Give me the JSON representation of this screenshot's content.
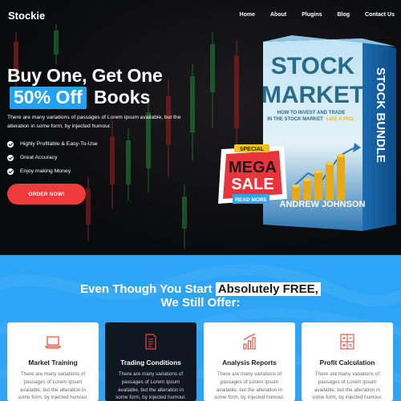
{
  "header": {
    "logo": "Stockie",
    "nav": [
      "Home",
      "About",
      "Plugins",
      "Blog",
      "Contact Us"
    ]
  },
  "hero": {
    "headline_line1": "Buy One, Get One",
    "headline_highlight": "50% Off",
    "headline_line2_rest": "Books",
    "description": "There are many variations of passages of Lorem Ipsum available, but the alteration in some form, by injected humour.",
    "features": [
      "Highly Profitable & Easy-To-Use",
      "Great Accuracy",
      "Enjoy making Money"
    ],
    "cta_label": "ORDER NOW!"
  },
  "book": {
    "title_line1": "STOCK",
    "title_line2": "MARKET",
    "subtitle_line1": "HOW TO INVEST AND TRADE",
    "subtitle_line2": "IN THE STOCK MARKET",
    "subtitle_highlight": "LIKE A PRO",
    "author": "ANDREW JOHNSON",
    "spine": "STOCK BUNDLE"
  },
  "badge": {
    "special": "SPECIAL",
    "line1": "MEGA",
    "line2": "SALE",
    "read_more": "READ MORE"
  },
  "offer": {
    "title_prefix": "Even Though You Start",
    "title_highlight": "Absolutely FREE,",
    "title_line2": "We Still Offer:",
    "cards": [
      {
        "title": "Market Training",
        "text": "There are many variations of passages of Lorem Ipsum available, but the alteration in some form, by injected humour.",
        "icon": "laptop-icon",
        "dark": false
      },
      {
        "title": "Trading Conditions",
        "text": "There are many variations of passages of Lorem Ipsum available, but the alteration in some form, by injected humour.",
        "icon": "document-icon",
        "dark": true
      },
      {
        "title": "Analysis Reports",
        "text": "There are many variations of passages of Lorem Ipsum available, but the alteration in some form, by injected humour.",
        "icon": "bar-chart-icon",
        "dark": false
      },
      {
        "title": "Profit Calculation",
        "text": "There are many variations of passages of Lorem Ipsum available, but the alteration in some form, by injected humour.",
        "icon": "calculator-icon",
        "dark": false
      }
    ]
  },
  "colors": {
    "accent_blue": "#2da4f5",
    "cta_red": "#ef3b3b",
    "icon_red": "#e8463b",
    "hero_bg": "#0b0d0f"
  }
}
